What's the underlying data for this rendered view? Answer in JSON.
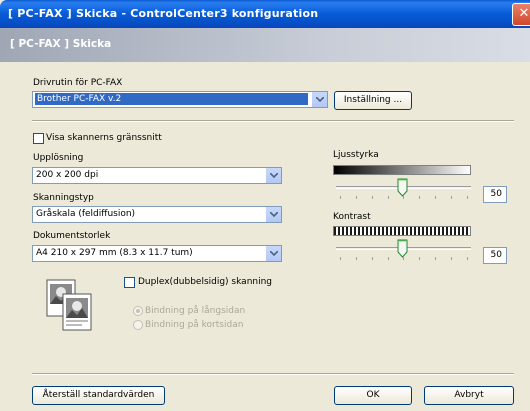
{
  "window": {
    "title": "[ PC-FAX ]  Skicka - ControlCenter3 konfiguration",
    "close": "✕"
  },
  "header": {
    "title": "[ PC-FAX ]  Skicka"
  },
  "driver": {
    "label": "Drivrutin för PC-FAX",
    "selected": "Brother PC-FAX v.2",
    "settings_button": "Inställning ..."
  },
  "show_scanner_ui": {
    "label": "Visa skannerns gränssnitt",
    "checked": false
  },
  "resolution": {
    "label": "Upplösning",
    "selected": "200 x 200 dpi"
  },
  "scan_type": {
    "label": "Skanningstyp",
    "selected": "Gråskala (feldiffusion)"
  },
  "document_size": {
    "label": "Dokumentstorlek",
    "selected": "A4 210 x 297 mm (8.3 x 11.7 tum)"
  },
  "brightness": {
    "label": "Ljusstyrka",
    "value": "50"
  },
  "contrast": {
    "label": "Kontrast",
    "value": "50"
  },
  "duplex": {
    "label": "Duplex(dubbelsidig) skanning",
    "checked": false,
    "options": [
      "Bindning på långsidan",
      "Bindning på kortsidan"
    ],
    "selected_index": 0
  },
  "footer": {
    "reset_button": "Återställ standardvärden",
    "ok_button": "OK",
    "cancel_button": "Avbryt"
  },
  "colors": {
    "titlebar": "#0a5ed8",
    "selection": "#316ac5",
    "dialog_bg": "#ece9d8"
  }
}
